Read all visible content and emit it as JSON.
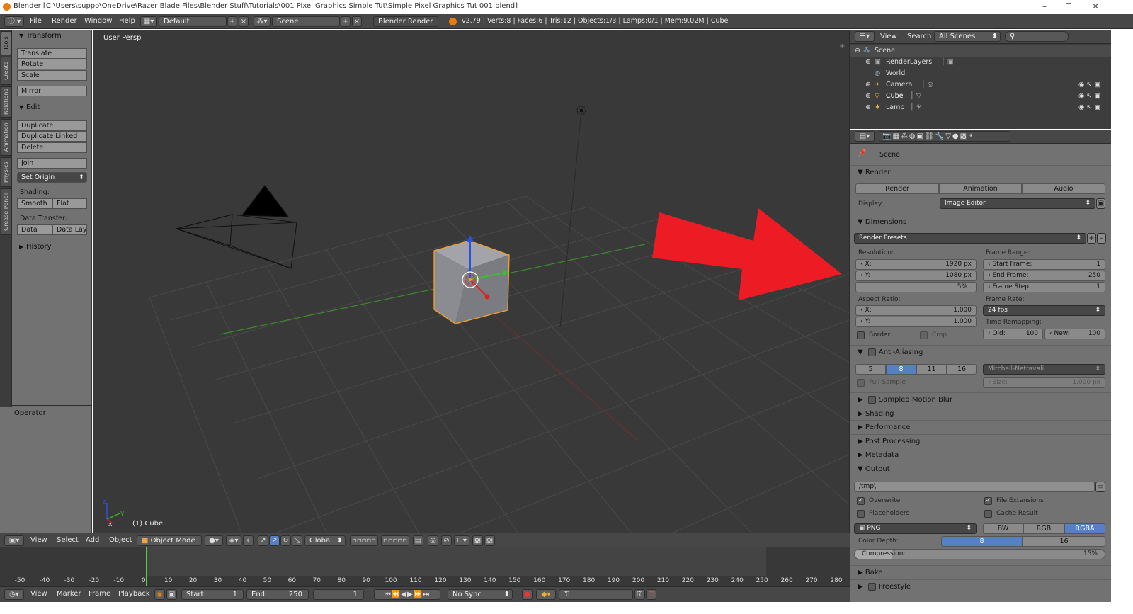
{
  "window": {
    "title": "Blender [C:\\Users\\suppo\\OneDrive\\Razer Blade Files\\Blender Stuff\\Tutorials\\001 Pixel Graphics Simple Tut\\Simple Pixel Graphics Tut 001.blend]",
    "minimize": "–",
    "maximize": "❐",
    "close": "✕"
  },
  "info": {
    "menus": [
      "File",
      "Render",
      "Window",
      "Help"
    ],
    "layout": "Default",
    "scene": "Scene",
    "engine": "Blender Render",
    "stats": "v2.79 | Verts:8 | Faces:6 | Tris:12 | Objects:1/3 | Lamps:0/1 | Mem:9.02M | Cube"
  },
  "tabs": [
    "Tools",
    "Create",
    "Relations",
    "Animation",
    "Physics",
    "Grease Pencil"
  ],
  "toolshelf": {
    "transform_header": "Transform",
    "transform_buttons": [
      "Translate",
      "Rotate",
      "Scale"
    ],
    "mirror": "Mirror",
    "edit_header": "Edit",
    "edit_buttons": [
      "Duplicate",
      "Duplicate Linked",
      "Delete"
    ],
    "join": "Join",
    "set_origin": "Set Origin",
    "shading_label": "Shading:",
    "smooth": "Smooth",
    "flat": "Flat",
    "data_transfer_label": "Data Transfer:",
    "data": "Data",
    "data_layout": "Data Layo",
    "history": "History",
    "operator": "Operator"
  },
  "viewport": {
    "view_label": "User Persp",
    "object_label": "(1) Cube",
    "colors": {
      "bg": "#393939",
      "grid": "#4a4a4a",
      "x_axis": "#8a2d2d",
      "y_axis": "#3c8c2c",
      "arrow": "#ed1c24",
      "cube": "#8d8d94",
      "select": "#f5a02d"
    }
  },
  "view3d_header": {
    "menus": [
      "View",
      "Select",
      "Add",
      "Object"
    ],
    "mode": "Object Mode",
    "orientation": "Global"
  },
  "timeline": {
    "ticks": [
      "-50",
      "-40",
      "-30",
      "-20",
      "-10",
      "0",
      "10",
      "20",
      "30",
      "40",
      "50",
      "60",
      "70",
      "80",
      "90",
      "100",
      "110",
      "120",
      "130",
      "140",
      "150",
      "160",
      "170",
      "180",
      "190",
      "200",
      "210",
      "220",
      "230",
      "240",
      "250",
      "260",
      "270",
      "280"
    ],
    "current_frame": 0
  },
  "timeline_header": {
    "menus": [
      "View",
      "Marker",
      "Frame",
      "Playback"
    ],
    "start_label": "Start:",
    "start_value": "1",
    "end_label": "End:",
    "end_value": "250",
    "current": "1",
    "sync": "No Sync"
  },
  "outliner": {
    "menus": [
      "View",
      "Search"
    ],
    "filter": "All Scenes",
    "items": [
      {
        "name": "Scene"
      },
      {
        "name": "RenderLayers"
      },
      {
        "name": "World"
      },
      {
        "name": "Camera"
      },
      {
        "name": "Cube"
      },
      {
        "name": "Lamp"
      }
    ]
  },
  "properties": {
    "context": "Scene",
    "render_header": "Render",
    "render_btn": "Render",
    "animation_btn": "Animation",
    "audio_btn": "Audio",
    "display_label": "Display:",
    "display_value": "Image Editor",
    "dimensions_header": "Dimensions",
    "render_presets": "Render Presets",
    "resolution_label": "Resolution:",
    "res_x_label": "X:",
    "res_x": "1920 px",
    "res_y_label": "Y:",
    "res_y": "1080 px",
    "res_pct": "5%",
    "frame_range_label": "Frame Range:",
    "start_frame_label": "Start Frame:",
    "start_frame": "1",
    "end_frame_label": "End Frame:",
    "end_frame": "250",
    "frame_step_label": "Frame Step:",
    "frame_step": "1",
    "aspect_label": "Aspect Ratio:",
    "aspect_x_label": "X:",
    "aspect_x": "1.000",
    "aspect_y_label": "Y:",
    "aspect_y": "1.000",
    "frame_rate_label": "Frame Rate:",
    "frame_rate": "24 fps",
    "time_remap_label": "Time Remapping:",
    "old_label": "Old:",
    "old_value": "100",
    "new_label": "New:",
    "new_value": "100",
    "border": "Border",
    "crop": "Crop",
    "aa_header": "Anti-Aliasing",
    "aa_samples": [
      "5",
      "8",
      "11",
      "16"
    ],
    "aa_filter": "Mitchell-Netravali",
    "full_sample": "Full Sample",
    "size_label": "Size:",
    "size_value": "1.000 px",
    "motion_blur": "Sampled Motion Blur",
    "shading": "Shading",
    "performance": "Performance",
    "post_processing": "Post Processing",
    "metadata": "Metadata",
    "output_header": "Output",
    "output_path": "/tmp\\",
    "overwrite": "Overwrite",
    "file_extensions": "File Extensions",
    "placeholders": "Placeholders",
    "cache_result": "Cache Result",
    "format": "PNG",
    "color_modes": [
      "BW",
      "RGB",
      "RGBA"
    ],
    "color_depth_label": "Color Depth:",
    "depths": [
      "8",
      "16"
    ],
    "compression_label": "Compression:",
    "compression_value": "15%",
    "compression_fraction": 0.15,
    "bake": "Bake",
    "freestyle": "Freestyle"
  }
}
